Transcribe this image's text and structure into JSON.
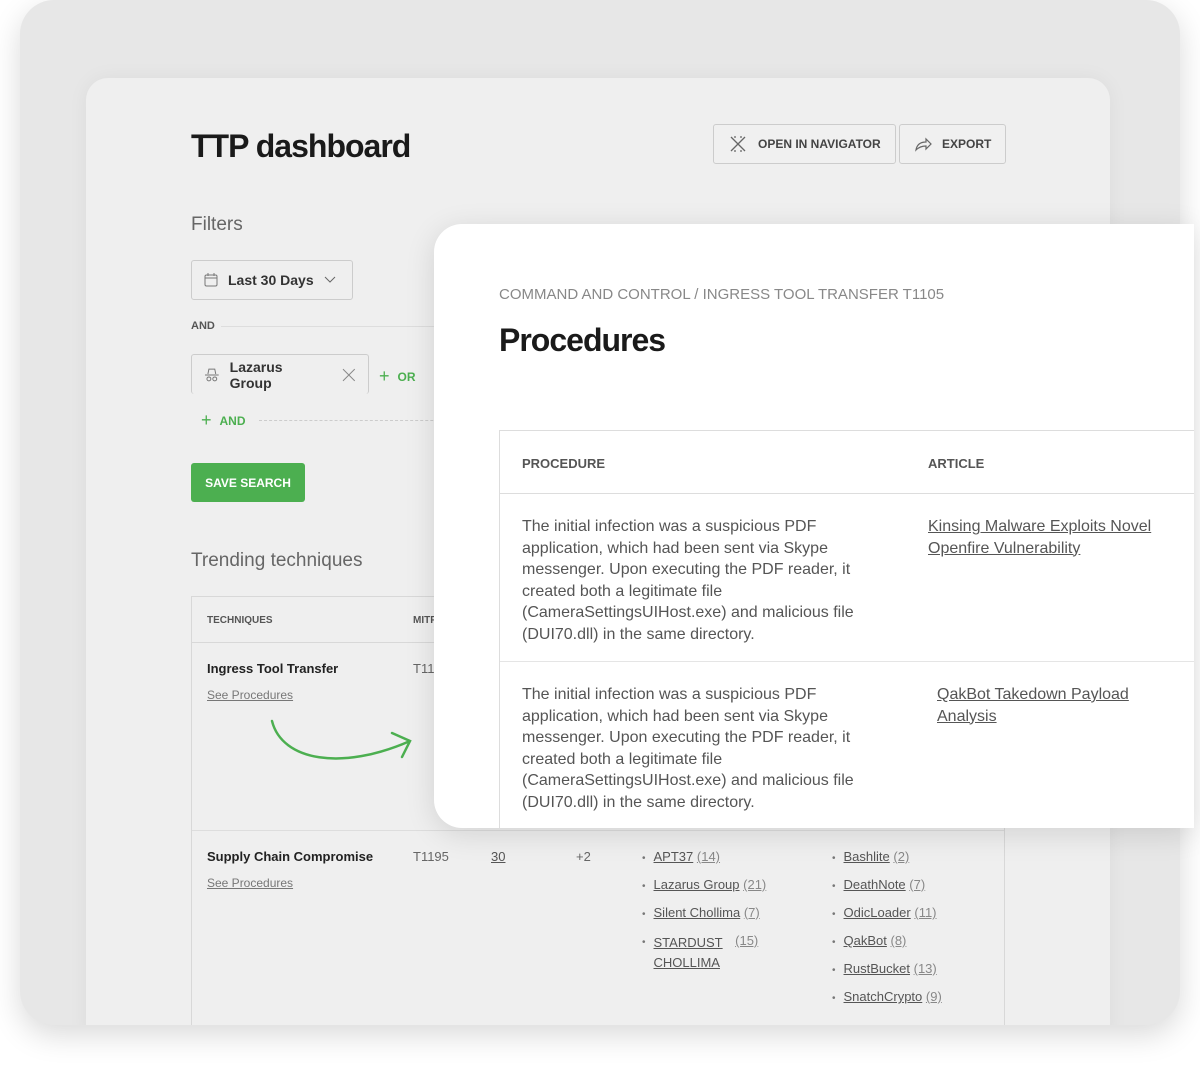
{
  "header": {
    "title": "TTP dashboard",
    "open_navigator": "OPEN IN NAVIGATOR",
    "export": "EXPORT"
  },
  "filters": {
    "title": "Filters",
    "date": "Last 30 Days",
    "and_label": "AND",
    "group": "Lazarus Group",
    "or_button": "OR",
    "and_button": "AND",
    "save": "SAVE SEARCH"
  },
  "trending": {
    "title": "Trending techniques",
    "headers": [
      "TECHNIQUES",
      "MITRE"
    ],
    "rows": [
      {
        "name": "Ingress Tool Transfer",
        "link": "See Procedures",
        "id": "T1105"
      },
      {
        "name": "Supply Chain Compromise",
        "link": "See Procedures",
        "id": "T1195",
        "count": "30",
        "extra": "+2",
        "groups": [
          {
            "n": "APT37",
            "c": "(14)"
          },
          {
            "n": "Lazarus Group",
            "c": "(21)"
          },
          {
            "n": "Silent Chollima",
            "c": "(7)"
          },
          {
            "n": "STARDUST CHOLLIMA",
            "c": "(15)"
          }
        ],
        "malware": [
          {
            "n": "Bashlite",
            "c": "(2)"
          },
          {
            "n": "DeathNote",
            "c": "(7)"
          },
          {
            "n": "OdicLoader",
            "c": "(11)"
          },
          {
            "n": "QakBot",
            "c": "(8)"
          },
          {
            "n": "RustBucket",
            "c": "(13)"
          },
          {
            "n": "SnatchCrypto",
            "c": "(9)"
          }
        ]
      }
    ]
  },
  "modal": {
    "breadcrumb": "COMMAND AND CONTROL / INGRESS TOOL TRANSFER T1105",
    "title": "Procedures",
    "headers": [
      "PROCEDURE",
      "ARTICLE"
    ],
    "rows": [
      {
        "procedure": "The initial infection was a suspicious PDF application, which had been sent via Skype messenger. Upon executing the PDF reader, it created both a legitimate file (CameraSettingsUIHost.exe) and malicious file (DUI70.dll) in the same directory.",
        "article": "Kinsing Malware Exploits Novel Openfire Vulnerability"
      },
      {
        "procedure": "The initial infection was a suspicious PDF application, which had been sent via Skype messenger. Upon executing the PDF reader, it created both a legitimate file (CameraSettingsUIHost.exe) and malicious file (DUI70.dll) in the same directory.",
        "article": "QakBot Takedown Payload Analysis"
      }
    ]
  },
  "colors": {
    "accent": "#4caf50"
  }
}
